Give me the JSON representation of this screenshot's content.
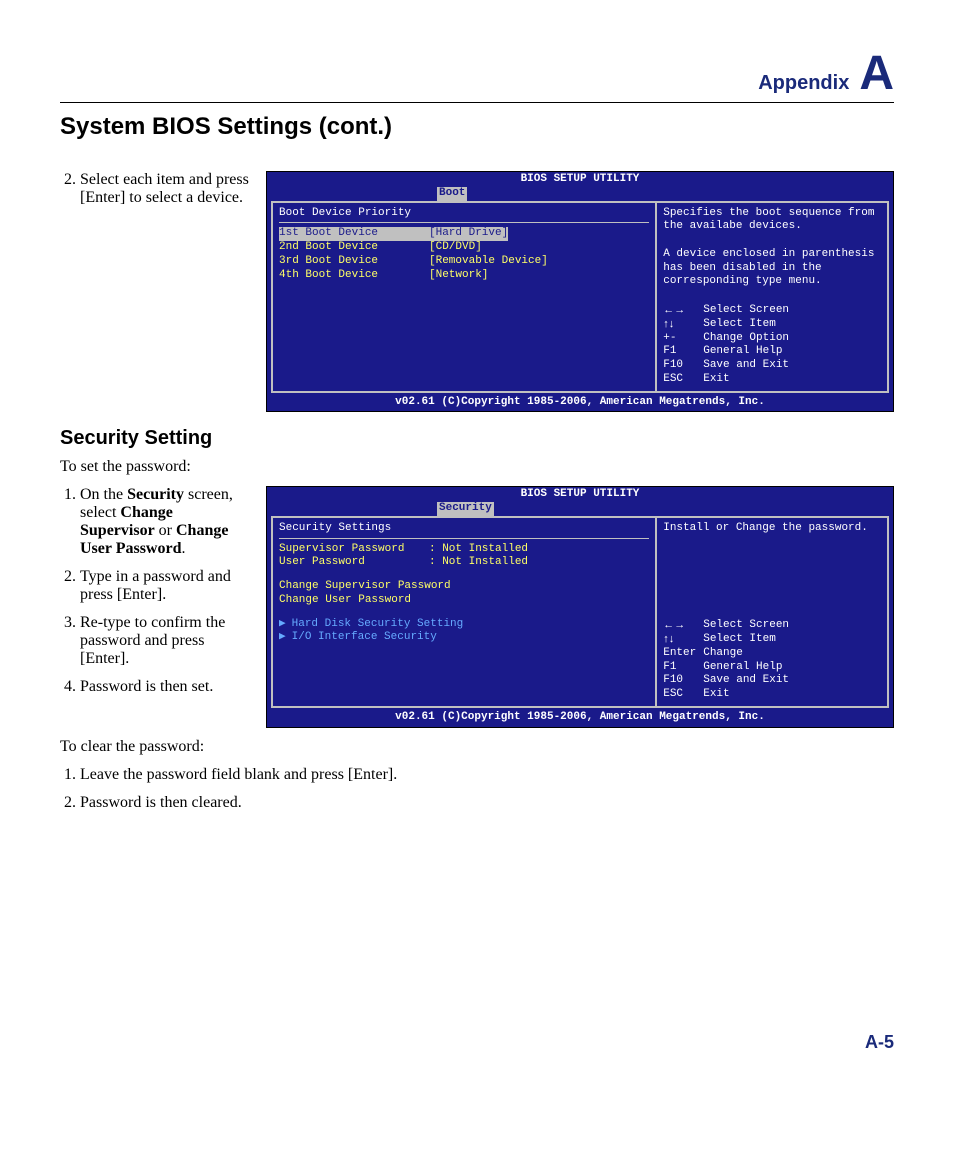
{
  "header": {
    "appendix": "Appendix",
    "letter": "A"
  },
  "titles": {
    "main": "System BIOS Settings (cont.)",
    "security": "Security Setting"
  },
  "sec1": {
    "step2": "Select each item and press [Enter] to select a device."
  },
  "bios1": {
    "title": "BIOS SETUP UTILITY",
    "tab": "Boot",
    "heading": "Boot Device Priority",
    "rows": [
      {
        "label": "1st Boot Device",
        "value": "[Hard Drive]"
      },
      {
        "label": "2nd Boot Device",
        "value": "[CD/DVD]"
      },
      {
        "label": "3rd Boot Device",
        "value": "[Removable Device]"
      },
      {
        "label": "4th Boot Device",
        "value": "[Network]"
      }
    ],
    "help": "Specifies the boot sequence from the availabe devices.\n\nA device enclosed in parenthesis has been disabled in the corresponding type menu.",
    "keys": [
      {
        "k": "←→",
        "d": "Select Screen"
      },
      {
        "k": "↑↓",
        "d": "Select Item"
      },
      {
        "k": "+-",
        "d": "Change Option"
      },
      {
        "k": "F1",
        "d": "General Help"
      },
      {
        "k": "F10",
        "d": "Save and Exit"
      },
      {
        "k": "ESC",
        "d": "Exit"
      }
    ],
    "footer": "v02.61 (C)Copyright 1985-2006, American Megatrends, Inc."
  },
  "sec2": {
    "intro": "To set the password:",
    "step1_pre": "On the ",
    "step1_b1": "Security",
    "step1_mid1": " screen, select ",
    "step1_b2": "Change Supervisor",
    "step1_mid2": " or ",
    "step1_b3": "Change User Password",
    "step1_end": ".",
    "step2": "Type in a password and press [Enter].",
    "step3": "Re-type to confirm the password and press [Enter].",
    "step4": "Password is then set.",
    "clear_intro": "To clear the password:",
    "clear1": "Leave the password field blank and press [Enter].",
    "clear2": "Password is then cleared."
  },
  "bios2": {
    "title": "BIOS SETUP UTILITY",
    "tab": "Security",
    "heading": "Security Settings",
    "p1": {
      "label": "Supervisor Password",
      "value": ": Not Installed"
    },
    "p2": {
      "label": "User Password",
      "value": ": Not Installed"
    },
    "l1": "Change Supervisor Password",
    "l2": "Change User Password",
    "s1": "Hard Disk Security Setting",
    "s2": "I/O Interface Security",
    "help": "Install or Change the password.",
    "keys": [
      {
        "k": "←→",
        "d": "Select Screen"
      },
      {
        "k": "↑↓",
        "d": "Select Item"
      },
      {
        "k": "Enter",
        "d": "Change"
      },
      {
        "k": "F1",
        "d": "General Help"
      },
      {
        "k": "F10",
        "d": "Save and Exit"
      },
      {
        "k": "ESC",
        "d": "Exit"
      }
    ],
    "footer": "v02.61 (C)Copyright 1985-2006, American Megatrends, Inc."
  },
  "footer": {
    "page": "A-5"
  }
}
